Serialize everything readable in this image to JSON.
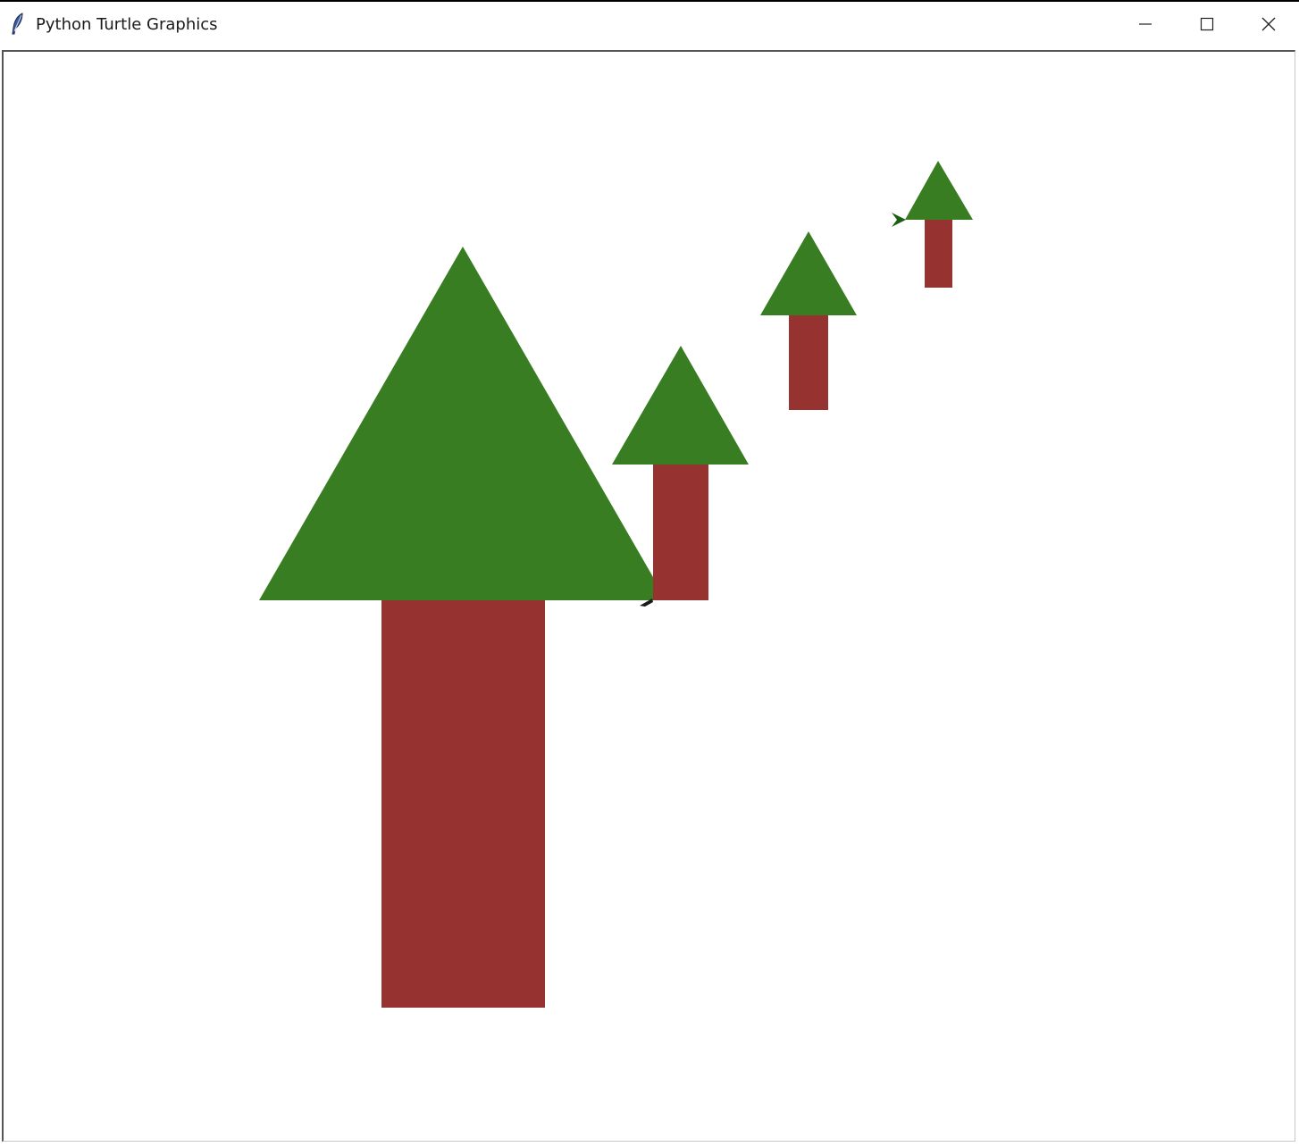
{
  "window": {
    "title": "Python Turtle Graphics",
    "icon": "feather-icon",
    "controls": {
      "minimize": "minimize-icon",
      "maximize": "maximize-icon",
      "close": "close-icon"
    }
  },
  "colors": {
    "foliage": "#387d22",
    "trunk": "#963330",
    "background": "#ffffff",
    "turtle_cursor": "#1b5e12"
  }
}
